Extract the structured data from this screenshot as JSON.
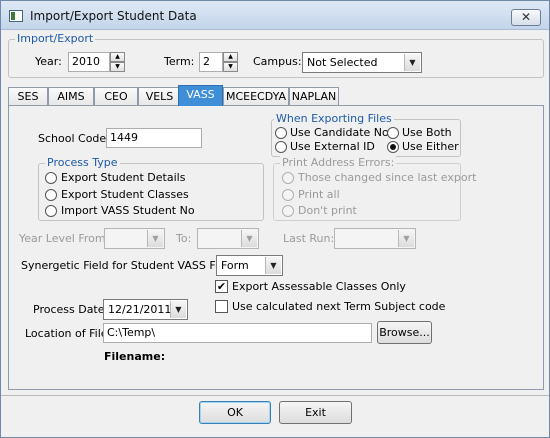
{
  "window": {
    "title": "Import/Export Student Data",
    "close_glyph": "✕"
  },
  "import_export": {
    "group_title": "Import/Export",
    "year_label": "Year:",
    "year_value": "2010",
    "term_label": "Term:",
    "term_value": "2",
    "campus_label": "Campus:",
    "campus_value": "Not Selected"
  },
  "tabs": [
    {
      "label": "SES"
    },
    {
      "label": "AIMS"
    },
    {
      "label": "CEO"
    },
    {
      "label": "VELS"
    },
    {
      "label": "VASS"
    },
    {
      "label": "MCEECDYA"
    },
    {
      "label": "NAPLAN"
    }
  ],
  "active_tab": "VASS",
  "vass": {
    "school_code_label": "School Code:",
    "school_code_value": "1449",
    "when_exporting": {
      "title": "When Exporting Files",
      "options": [
        "Use Candidate No",
        "Use Both",
        "Use External ID",
        "Use Either"
      ],
      "selected": "Use Either"
    },
    "process_type": {
      "title": "Process Type",
      "options": [
        "Export Student Details",
        "Export Student Classes",
        "Import VASS Student No"
      ]
    },
    "print_address_errors": {
      "title": "Print Address Errors:",
      "options": [
        "Those changed since last export",
        "Print all",
        "Don't print"
      ]
    },
    "year_level_from_label": "Year Level From:",
    "to_label": "To:",
    "last_run_label": "Last Run:",
    "synergetic_field_label": "Synergetic Field for Student VASS Form:",
    "synergetic_field_value": "Form",
    "export_assessable_label": "Export Assessable Classes Only",
    "export_assessable_checked": true,
    "use_calculated_label": "Use calculated next Term Subject code",
    "use_calculated_checked": false,
    "process_date_label": "Process Date:",
    "process_date_value": "12/21/2011",
    "location_label": "Location of File:",
    "location_value": "C:\\Temp\\",
    "browse_label": "Browse...",
    "filename_label": "Filename:"
  },
  "footer": {
    "ok_label": "OK",
    "exit_label": "Exit"
  },
  "icons": {
    "check_glyph": "✔",
    "spin_up": "▲",
    "spin_down": "▼",
    "dropdown": "▼"
  }
}
